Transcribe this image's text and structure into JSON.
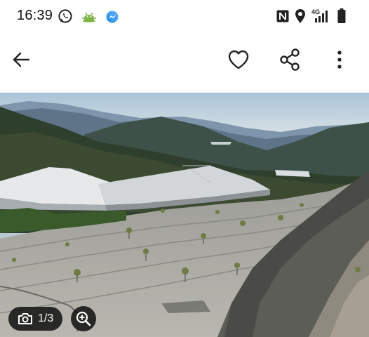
{
  "status_bar": {
    "time": "16:39",
    "left_icons": [
      "whatsapp-icon",
      "android-debug-icon",
      "messenger-icon"
    ],
    "right_icons": [
      "nfc-icon",
      "location-icon",
      "signal-4g-icon",
      "battery-icon"
    ],
    "network_label": "4G"
  },
  "app_bar": {
    "back_icon": "arrow-left-icon",
    "actions": [
      "heart-icon",
      "share-icon",
      "more-vertical-icon"
    ]
  },
  "gallery": {
    "counter": "1/3",
    "counter_icon": "camera-icon",
    "zoom_icon": "zoom-in-icon"
  }
}
